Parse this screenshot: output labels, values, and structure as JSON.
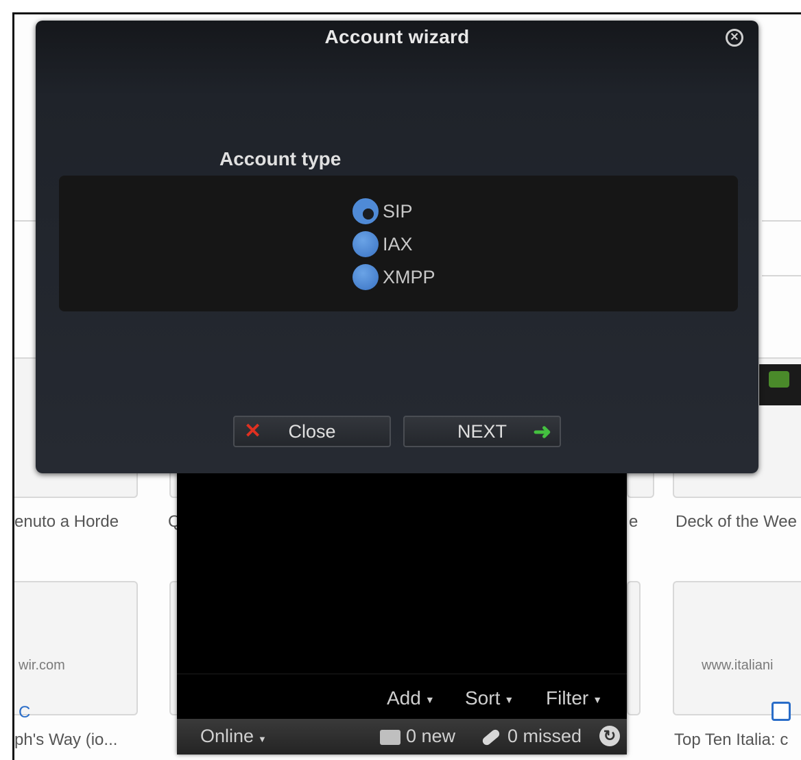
{
  "dialog": {
    "title": "Account wizard",
    "section_label": "Account type",
    "options": [
      {
        "label": "SIP",
        "checked": true
      },
      {
        "label": "IAX",
        "checked": false
      },
      {
        "label": "XMPP",
        "checked": false
      }
    ],
    "close_button": "Close",
    "next_button": "NEXT"
  },
  "app": {
    "menu": {
      "add": "Add",
      "sort": "Sort",
      "filter": "Filter"
    },
    "status": {
      "presence": "Online",
      "new_messages": "0 new",
      "missed_calls": "0 missed"
    }
  },
  "background": {
    "tiles_top": [
      "enuto a Horde",
      "Deck of the Wee"
    ],
    "urls": [
      "wir.com",
      "www.italiani"
    ],
    "tiles_bottom": [
      "ph's Way (io...",
      "Top Ten Italia: c"
    ],
    "fragment_q": "Q",
    "fragment_e": "e",
    "fragment_c": "C"
  },
  "colors": {
    "dialog_bg": "#1f232a",
    "radio_blue": "#4f8ad6",
    "close_red": "#e03020",
    "next_green": "#44c040"
  }
}
